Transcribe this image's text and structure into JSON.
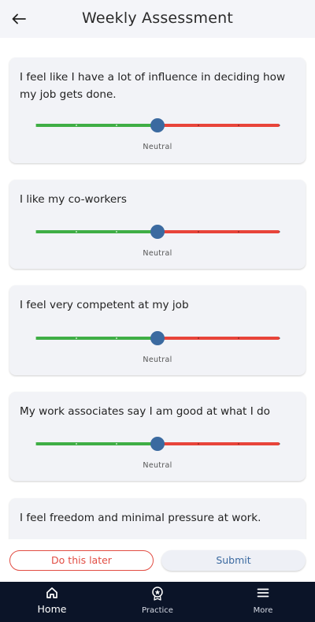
{
  "header": {
    "title": "Weekly Assessment",
    "back_icon": "arrow-left-icon"
  },
  "colors": {
    "positive_track": "#3fae45",
    "negative_track": "#e8443a",
    "thumb": "#3b6aa0",
    "later_button": "#e24d43",
    "nav_background": "#0b1428"
  },
  "slider_scale": {
    "steps": 7,
    "midpoint": 4
  },
  "questions": [
    {
      "text": "I feel like I have a lot of influence in deciding how my job gets done.",
      "value": 4,
      "value_label": "Neutral"
    },
    {
      "text": "I like my co-workers",
      "value": 4,
      "value_label": "Neutral"
    },
    {
      "text": "I feel very competent at my job",
      "value": 4,
      "value_label": "Neutral"
    },
    {
      "text": "My work associates say I am good at what I do",
      "value": 4,
      "value_label": "Neutral"
    },
    {
      "text": "I feel freedom and minimal pressure at work."
    }
  ],
  "actions": {
    "later_label": "Do this later",
    "submit_label": "Submit"
  },
  "nav": {
    "items": [
      {
        "label": "Home",
        "icon": "home-icon",
        "active": true
      },
      {
        "label": "Practice",
        "icon": "badge-icon",
        "active": false
      },
      {
        "label": "More",
        "icon": "menu-icon",
        "active": false
      }
    ]
  }
}
